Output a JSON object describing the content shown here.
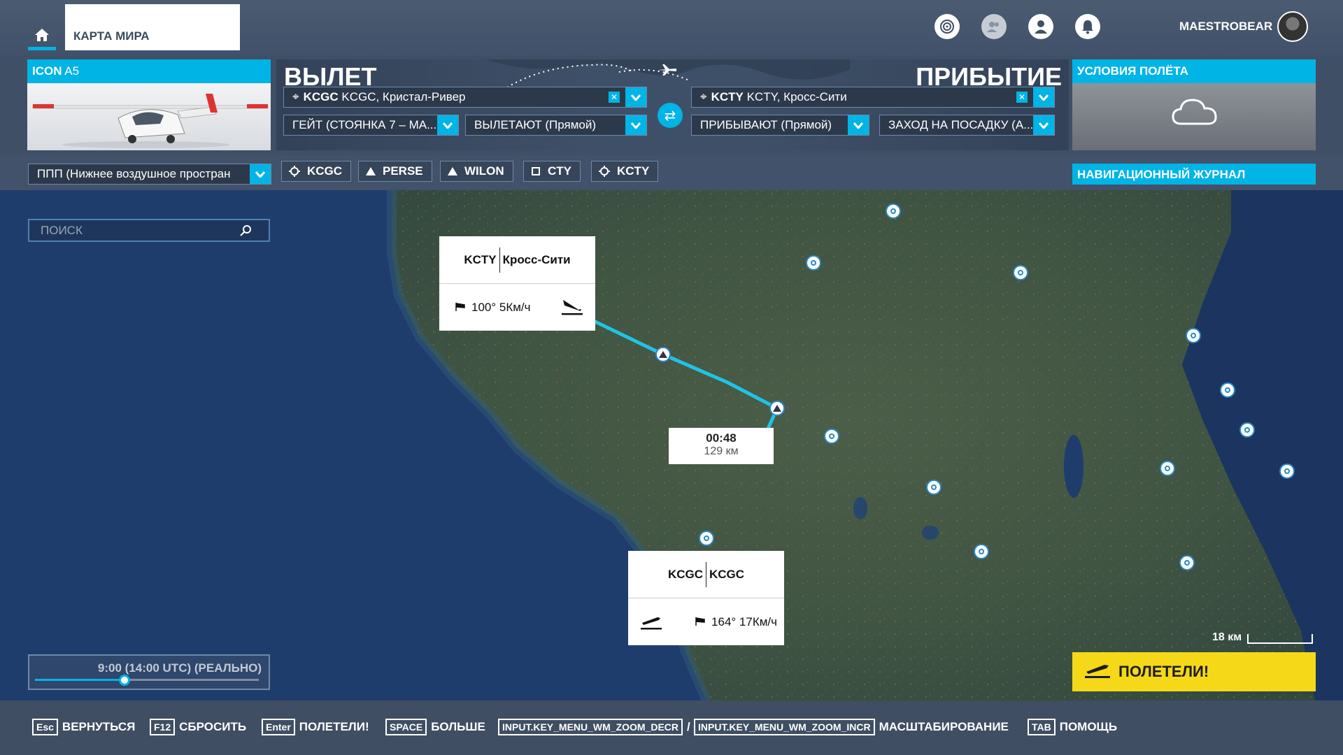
{
  "topbar": {
    "world_map_tab": "КАРТА МИРА",
    "username": "MAESTROBEAR",
    "accent": "#00b4e6"
  },
  "aircraft": {
    "label_brand": "ICON",
    "label_model": " A5"
  },
  "departure": {
    "title": "ВЫЛЕТ",
    "airport_code": "KCGC",
    "airport_text": " KCGC, Кристал-Ривер",
    "gate": "ГЕЙТ (СТОЯНКА 7 – МА...",
    "departing": "ВЫЛЕТАЮТ (Прямой)"
  },
  "arrival": {
    "title": "ПРИБЫТИЕ",
    "airport_code": "KCTY",
    "airport_text": " KCTY, Кросс-Сити",
    "arriving": "ПРИБЫВАЮТ (Прямой)",
    "approach": "ЗАХОД НА ПОСАДКУ (А..."
  },
  "conditions": {
    "title": "УСЛОВИЯ ПОЛЁТА",
    "icon": "cloud-icon"
  },
  "flight_type": "ППП (Нижнее воздушное простран",
  "waypoints": [
    {
      "label": "KCGC",
      "icon": "airport-icon"
    },
    {
      "label": "PERSE",
      "icon": "triangle-icon"
    },
    {
      "label": "WILON",
      "icon": "triangle-icon"
    },
    {
      "label": "CTY",
      "icon": "vor-icon"
    },
    {
      "label": "KCTY",
      "icon": "airport-icon"
    }
  ],
  "navlog": "НАВИГАЦИОННЫЙ ЖУРНАЛ",
  "search": {
    "placeholder": "ПОИСК"
  },
  "arrival_card": {
    "code": "KCTY",
    "name": "Кросс-Сити",
    "wind": "100° 5Км/ч"
  },
  "departure_card": {
    "code": "KCGC",
    "name": "KCGC",
    "wind": "164° 17Км/ч"
  },
  "leg": {
    "time": "00:48",
    "distance": "129 км"
  },
  "time_of_day": {
    "text": "9:00 (14:00 UTC) (РЕАЛЬНО)",
    "slider_fraction": 0.4
  },
  "scale": "18 км",
  "fly_button": "ПОЛЕТЕЛИ!",
  "hints": [
    {
      "key": "Esc",
      "label": "ВЕРНУТЬСЯ"
    },
    {
      "key": "F12",
      "label": "СБРОСИТЬ"
    },
    {
      "key": "Enter",
      "label": "ПОЛЕТЕЛИ!"
    },
    {
      "key": "SPACE",
      "label": "БОЛЬШЕ"
    },
    {
      "key": "INPUT.KEY_MENU_WM_ZOOM_DECR",
      "label": "/"
    },
    {
      "key": "INPUT.KEY_MENU_WM_ZOOM_INCR",
      "label": "МАСШТАБИРОВАНИЕ"
    },
    {
      "key": "TAB",
      "label": "ПОМОЩЬ"
    }
  ]
}
